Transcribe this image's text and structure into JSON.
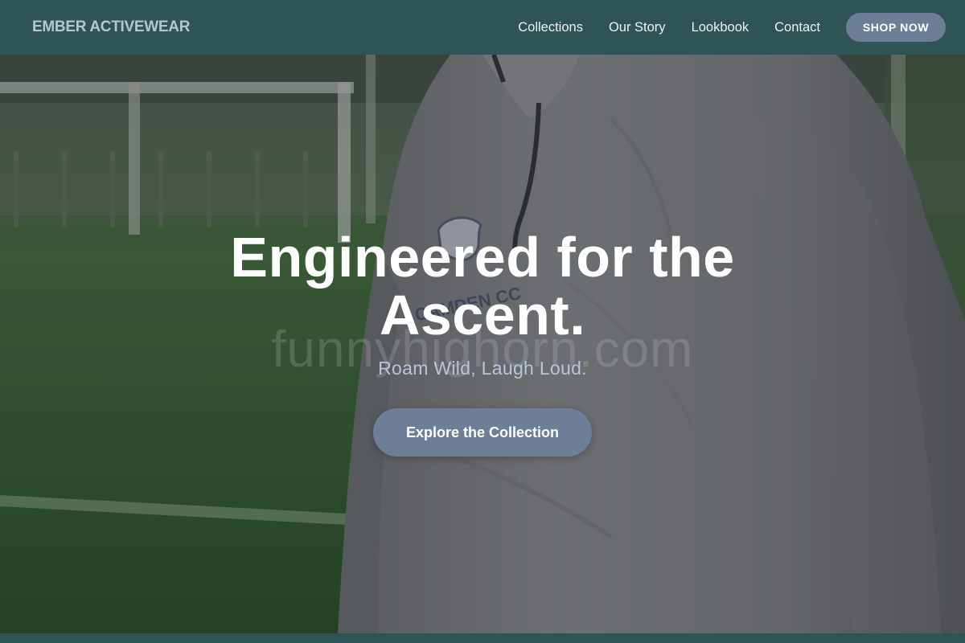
{
  "brand": {
    "name": "EMBER ACTIVEWEAR"
  },
  "nav": {
    "links": [
      "Collections",
      "Our Story",
      "Lookbook",
      "Contact"
    ],
    "cta_label": "SHOP NOW"
  },
  "hero": {
    "title": "Engineered for the Ascent.",
    "subtitle": "Roam Wild, Laugh Loud.",
    "cta_label": "Explore the Collection",
    "watermark": "funnyhighorn.com",
    "image_description_icon": "athlete-photo"
  },
  "colors": {
    "nav_bg": "#2f5456",
    "brand_text": "#b5c5d6",
    "button_bg": "#6c7f97",
    "subtitle_text": "#b7c6d8"
  }
}
